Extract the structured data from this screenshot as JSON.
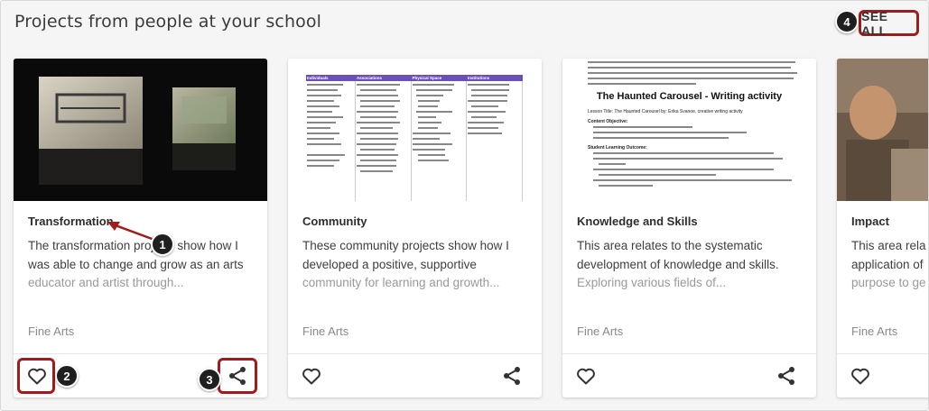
{
  "header": {
    "title": "Projects from people at your school",
    "see_all": "SEE ALL"
  },
  "cards": [
    {
      "title": "Transformation",
      "desc_line1": "The transformation proj",
      "desc_line1b": " show how I",
      "desc_line2": "was able to change and grow as an arts",
      "desc_line3": "educator and artist through...",
      "tag": "Fine Arts"
    },
    {
      "title": "Community",
      "desc_line1": "These community projects show how I",
      "desc_line2": "developed a positive, supportive",
      "desc_line3": "community for learning and growth...",
      "tag": "Fine Arts",
      "thumb_headers": [
        "Individuals",
        "Associations",
        "Physical Space",
        "Institutions"
      ]
    },
    {
      "title": "Knowledge and Skills",
      "desc_line1": "This area relates to the systematic",
      "desc_line2": "development of knowledge and skills.",
      "desc_line3": "Exploring various fields of...",
      "tag": "Fine Arts",
      "thumb_heading": "The Haunted Carousel - Writing activity",
      "thumb_lesson": "Lesson Title: The Haunted Carousel by: Erika Svanoe, creative writing activity",
      "thumb_objective": "Content Objective:",
      "thumb_outcome": "Student Learning Outcome:"
    },
    {
      "title": "Impact",
      "desc_line1": "This area rela",
      "desc_line2": "application of",
      "desc_line3": "purpose to ge",
      "tag": "Fine Arts"
    }
  ],
  "callouts": [
    "1",
    "2",
    "3",
    "4"
  ],
  "colors": {
    "highlight": "#a01c1c",
    "badge": "#1f1f1f",
    "table_header": "#6b4fb8"
  },
  "icons": [
    "heart-icon",
    "share-icon"
  ]
}
